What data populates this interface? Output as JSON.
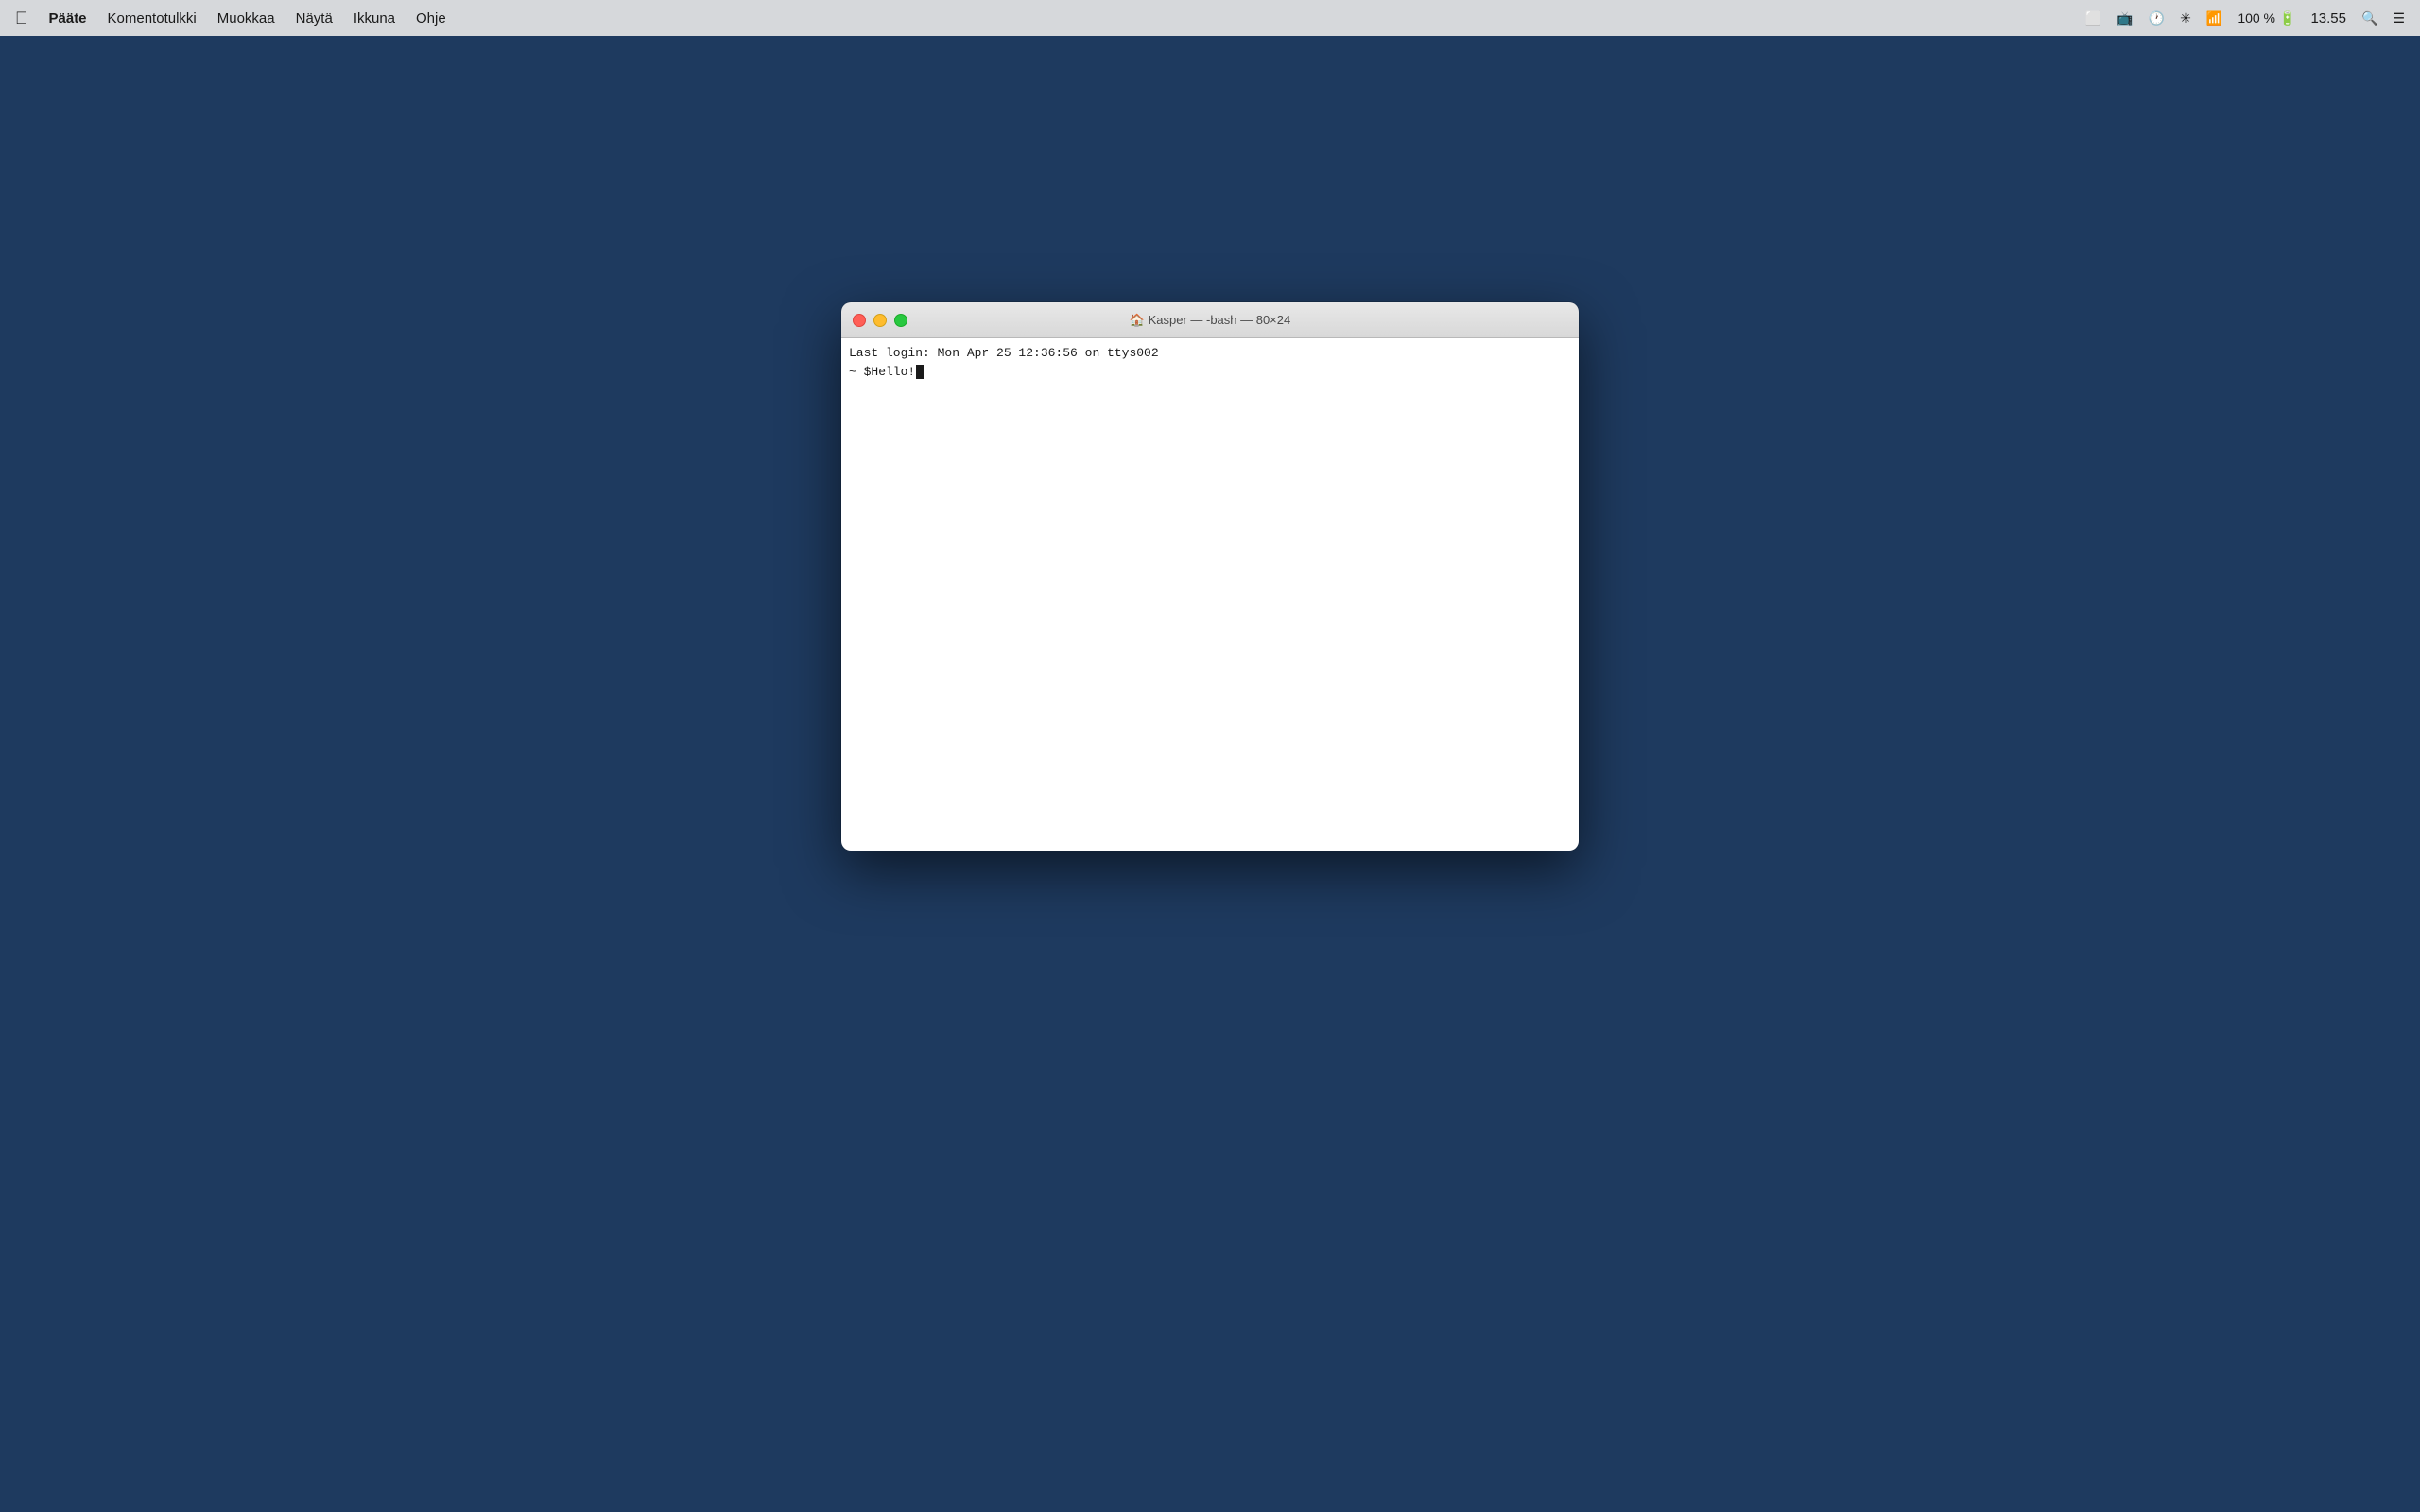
{
  "menubar": {
    "apple_label": "",
    "app_name": "Pääte",
    "menus": [
      {
        "label": "Komentotulkki"
      },
      {
        "label": "Muokkaa"
      },
      {
        "label": "Näytä"
      },
      {
        "label": "Ikkuna"
      },
      {
        "label": "Ohje"
      }
    ],
    "status": {
      "battery_percent": "100 %",
      "clock": "13.55"
    }
  },
  "terminal": {
    "title": "🏠 Kasper — -bash — 80×24",
    "title_emoji": "🏠",
    "title_text": "Kasper — -bash — 80×24",
    "last_login_line": "Last login: Mon Apr 25 12:36:56 on ttys002",
    "prompt_prefix": "~ $ ",
    "prompt_command": "Hello!"
  },
  "traffic_lights": {
    "close_label": "close",
    "minimize_label": "minimize",
    "maximize_label": "maximize"
  }
}
